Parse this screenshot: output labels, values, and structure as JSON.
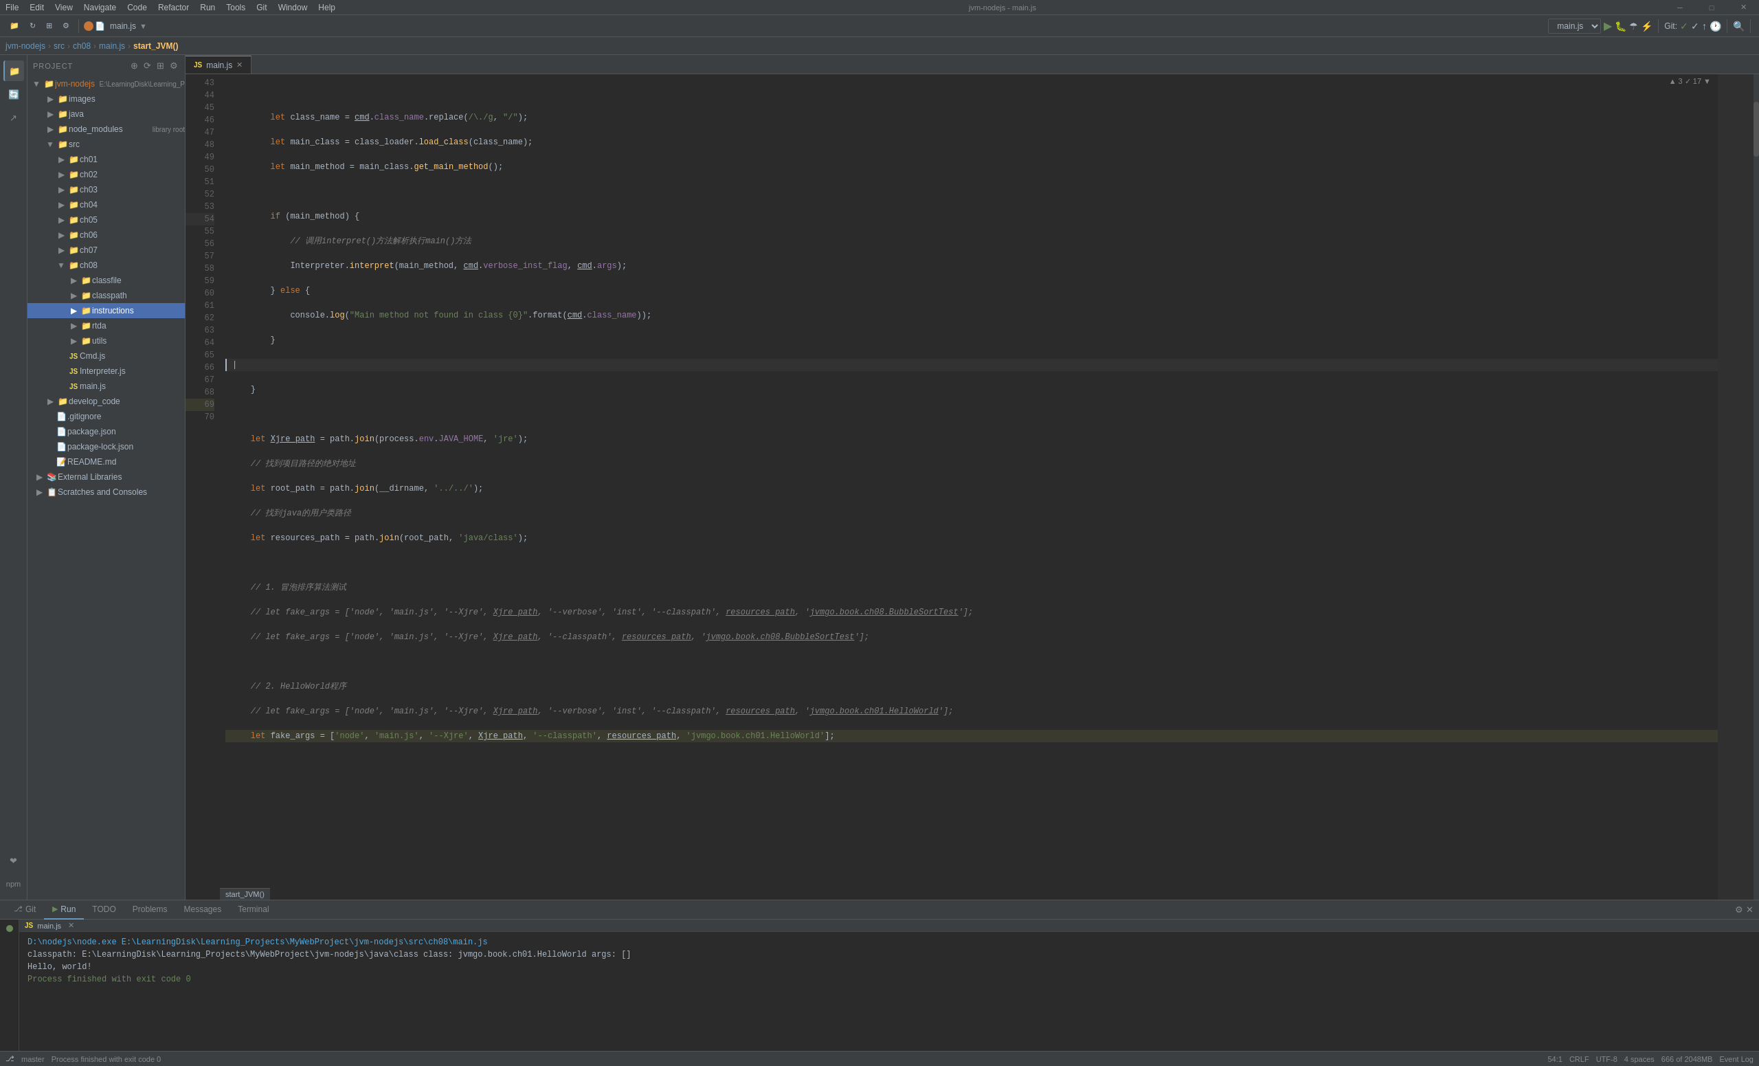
{
  "window": {
    "title": "jvm-nodejs - main.js",
    "minimize": "─",
    "maximize": "□",
    "close": "✕"
  },
  "menubar": {
    "items": [
      "File",
      "Edit",
      "View",
      "Navigate",
      "Code",
      "Refactor",
      "Run",
      "Tools",
      "Git",
      "Window",
      "Help"
    ]
  },
  "toolbar": {
    "run_config": "main.js",
    "search_icon": "🔍",
    "settings_icon": "⚙"
  },
  "breadcrumb": {
    "project": "jvm-nodejs",
    "src": "src",
    "ch08": "ch08",
    "file": "main.js",
    "func": "start_JVM()"
  },
  "sidebar": {
    "title": "Project",
    "root": "jvm-nodejs",
    "root_path": "E:\\LearningDisk\\Learning_P",
    "items": [
      {
        "label": "images",
        "type": "folder",
        "depth": 2
      },
      {
        "label": "java",
        "type": "folder",
        "depth": 2
      },
      {
        "label": "node_modules",
        "type": "folder",
        "badge": "library root",
        "depth": 2
      },
      {
        "label": "src",
        "type": "folder",
        "depth": 2,
        "expanded": true
      },
      {
        "label": "ch01",
        "type": "folder",
        "depth": 3
      },
      {
        "label": "ch02",
        "type": "folder",
        "depth": 3
      },
      {
        "label": "ch03",
        "type": "folder",
        "depth": 3
      },
      {
        "label": "ch04",
        "type": "folder",
        "depth": 3
      },
      {
        "label": "ch05",
        "type": "folder",
        "depth": 3
      },
      {
        "label": "ch06",
        "type": "folder",
        "depth": 3
      },
      {
        "label": "ch07",
        "type": "folder",
        "depth": 3
      },
      {
        "label": "ch08",
        "type": "folder",
        "depth": 3,
        "expanded": true
      },
      {
        "label": "classfile",
        "type": "folder",
        "depth": 4
      },
      {
        "label": "classpath",
        "type": "folder",
        "depth": 4
      },
      {
        "label": "instructions",
        "type": "folder",
        "depth": 4,
        "selected": true
      },
      {
        "label": "rtda",
        "type": "folder",
        "depth": 4
      },
      {
        "label": "utils",
        "type": "folder",
        "depth": 4
      },
      {
        "label": "Cmd.js",
        "type": "js",
        "depth": 4
      },
      {
        "label": "Interpreter.js",
        "type": "js",
        "depth": 4
      },
      {
        "label": "main.js",
        "type": "js",
        "depth": 4
      },
      {
        "label": "develop_code",
        "type": "folder",
        "depth": 2
      },
      {
        "label": ".gitignore",
        "type": "file",
        "depth": 2
      },
      {
        "label": "package.json",
        "type": "json",
        "depth": 2
      },
      {
        "label": "package-lock.json",
        "type": "json",
        "depth": 2
      },
      {
        "label": "README.md",
        "type": "md",
        "depth": 2
      },
      {
        "label": "External Libraries",
        "type": "folder",
        "depth": 1
      },
      {
        "label": "Scratches and Consoles",
        "type": "folder",
        "depth": 1
      }
    ]
  },
  "tab": {
    "label": "main.js",
    "modified": false
  },
  "editor": {
    "top_info": "▲ 3  ✓ 17  ▼",
    "lines": [
      {
        "num": 43,
        "content": ""
      },
      {
        "num": 44,
        "content": "        let class_name = cmd.class_name.replace(/\\./g, \"/\");"
      },
      {
        "num": 45,
        "content": "        let main_class = class_loader.load_class(class_name);"
      },
      {
        "num": 46,
        "content": "        let main_method = main_class.get_main_method();"
      },
      {
        "num": 47,
        "content": ""
      },
      {
        "num": 48,
        "content": "        if (main_method) {"
      },
      {
        "num": 49,
        "content": "            // 调用interpret()方法解析执行main()方法"
      },
      {
        "num": 50,
        "content": "            Interpreter.interpret(main_method, cmd.verbose_inst_flag, cmd.args);"
      },
      {
        "num": 51,
        "content": "        } else {"
      },
      {
        "num": 52,
        "content": "            console.log(\"Main method not found in class {0}\".format(cmd.class_name));"
      },
      {
        "num": 53,
        "content": "        }"
      },
      {
        "num": 54,
        "content": ""
      },
      {
        "num": 55,
        "content": "    }"
      },
      {
        "num": 56,
        "content": ""
      },
      {
        "num": 57,
        "content": "    let Xjre_path = path.join(process.env.JAVA_HOME, 'jre');"
      },
      {
        "num": 58,
        "content": "    // 找到项目路径的绝对地址"
      },
      {
        "num": 59,
        "content": "    let root_path = path.join(__dirname, '../../');"
      },
      {
        "num": 60,
        "content": "    // 找到java的用户类路径"
      },
      {
        "num": 61,
        "content": "    let resources_path = path.join(root_path, 'java/class');"
      },
      {
        "num": 62,
        "content": ""
      },
      {
        "num": 63,
        "content": "    // 1. 冒泡排序算法测试"
      },
      {
        "num": 64,
        "content": "    // let fake_args = ['node', 'main.js', '--Xjre', Xjre_path, '--verbose', 'inst', '--classpath', resources_path, 'jvmgo.book.ch08.BubbleSortTest'];"
      },
      {
        "num": 65,
        "content": "    // let fake_args = ['node', 'main.js', '--Xjre', Xjre_path, '--classpath', resources_path, 'jvmgo.book.ch08.BubbleSortTest'];"
      },
      {
        "num": 66,
        "content": ""
      },
      {
        "num": 67,
        "content": "    // 2. HelloWorld程序"
      },
      {
        "num": 68,
        "content": "    // let fake_args = ['node', 'main.js', '--Xjre', Xjre_path, '--verbose', 'inst', '--classpath', resources_path, 'jvmgo.book.ch01.HelloWorld'];"
      },
      {
        "num": 69,
        "content": "    let fake_args = ['node', 'main.js', '--Xjre', Xjre_path, '--classpath', resources_path, 'jvmgo.book.ch01.HelloWorld'];"
      },
      {
        "num": 70,
        "content": ""
      }
    ],
    "func_label": "start_JVM()"
  },
  "run_panel": {
    "label": "Run",
    "tab_label": "main.js",
    "cmd": "D:\\nodejs\\node.exe E:\\LearningDisk\\Learning_Projects\\MyWebProject\\jvm-nodejs\\src\\ch08\\main.js",
    "output1": "classpath: E:\\LearningDisk\\Learning_Projects\\MyWebProject\\jvm-nodejs\\java\\class class: jvmgo.book.ch01.HelloWorld args: []",
    "output2": "Hello, world!",
    "output3": "",
    "exit_msg": "Process finished with exit code 0",
    "run_indicator": "●"
  },
  "bottom_tabs": [
    {
      "label": "Git",
      "active": false
    },
    {
      "label": "Run",
      "active": true
    },
    {
      "label": "TODO",
      "active": false
    },
    {
      "label": "Problems",
      "active": false
    },
    {
      "label": "Messages",
      "active": false
    },
    {
      "label": "Terminal",
      "active": false
    }
  ],
  "status_bar": {
    "process_msg": "Process finished with exit code 0",
    "position": "54:1",
    "line_ending": "CRLF",
    "encoding": "UTF-8",
    "indent": "4 spaces",
    "branch": "master",
    "event_log": "Event Log",
    "line_count": "666 of 2048MB",
    "git_status": "Git:"
  },
  "activity": {
    "items": [
      "📁",
      "🔍",
      "🔧",
      "↗",
      "❤"
    ]
  }
}
